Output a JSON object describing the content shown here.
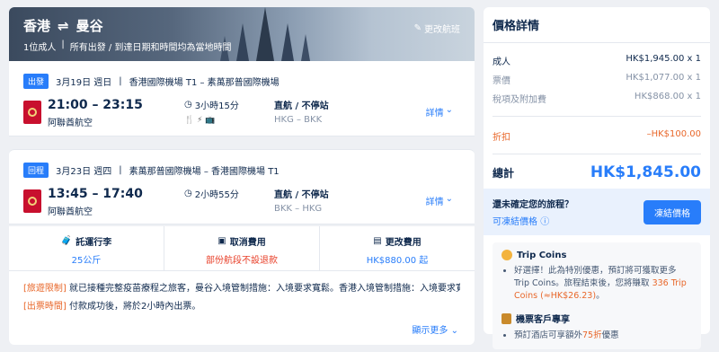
{
  "header": {
    "origin": "香港",
    "swap_icon": "⇌",
    "destination": "曼谷",
    "pax": "1位成人",
    "sep": "|",
    "note": "所有出發 / 到達日期和時間均為當地時間",
    "change": "更改航班"
  },
  "flights": [
    {
      "tag": "出發",
      "date": "3月19日 週日",
      "route": "香港國際機場 T1 – 素萬那普國際機場",
      "time": "21:00 – 23:15",
      "airline": "阿聯酋航空",
      "duration": "3小時15分",
      "facilities": "🍴 ⚡ 📺",
      "stop": "直航 / 不停站",
      "codes": "HKG – BKK",
      "detail": "詳情"
    },
    {
      "tag": "回程",
      "date": "3月23日 週四",
      "route": "素萬那普國際機場 – 香港國際機場 T1",
      "time": "13:45 – 17:40",
      "airline": "阿聯酋航空",
      "duration": "2小時55分",
      "facilities": "",
      "stop": "直航 / 不停站",
      "codes": "BKK – HKG",
      "detail": "詳情"
    }
  ],
  "fees": [
    {
      "title": "託運行李",
      "value": "25公斤"
    },
    {
      "title": "取消費用",
      "value": "部份航段不設退款"
    },
    {
      "title": "更改費用",
      "value": "HK$880.00 起"
    }
  ],
  "notes": {
    "travel_label": "[旅遊限制]",
    "travel_text": " 就已接種完整疫苗療程之旅客，曼谷入境管制措施：入境要求寬鬆。香港入境管制措施：入境要求寬鬆...",
    "ticket_label": "[出票時間]",
    "ticket_text": " 付款成功後，將於2小時內出票。",
    "more": "顯示更多"
  },
  "price": {
    "title": "價格詳情",
    "adult_label": "成人",
    "adult_value": "HK$1,945.00 x 1",
    "fare_label": "票價",
    "fare_value": "HK$1,077.00 x 1",
    "tax_label": "稅項及附加費",
    "tax_value": "HK$868.00 x 1",
    "discount_label": "折扣",
    "discount_value": "–HK$100.00",
    "total_label": "總計",
    "total_value": "HK$1,845.00",
    "freeze_q": "還未確定您的旅程？",
    "freeze_link": "可凍結價格",
    "freeze_button": "凍結價格"
  },
  "coins": {
    "title": "Trip Coins",
    "line1": "好選擇！此為特別優惠，預訂將可獲取更多 Trip Coins。旅程結束後，您將賺取",
    "amount": "336 Trip Coins (≈HK$26.23)",
    "line1_end": "。",
    "member_title": "機票客戶專享",
    "member_text_a": "預訂酒店可享額外",
    "member_hl": "75折",
    "member_text_b": "優惠"
  }
}
